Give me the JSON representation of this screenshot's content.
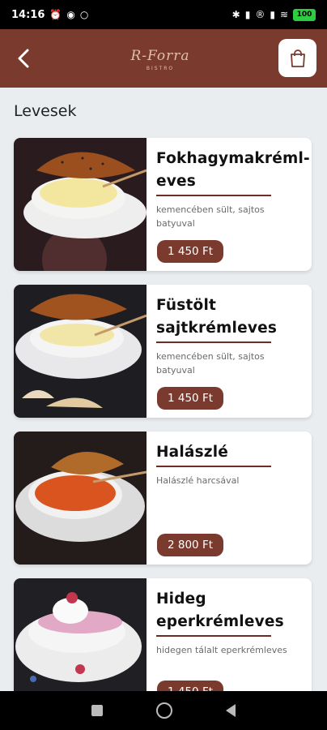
{
  "status_bar": {
    "time": "14:16",
    "left_icons": [
      "alarm-icon",
      "messenger-icon",
      "ring-icon"
    ],
    "right_icons": [
      "bluetooth-icon",
      "signal-icon",
      "roaming-icon",
      "signal-icon",
      "wifi-icon"
    ],
    "battery": "100"
  },
  "header": {
    "logo_text": "R-Forra",
    "logo_sub": "BISTRO",
    "brand_color": "#7a3a2e"
  },
  "section": {
    "title": "Levesek"
  },
  "items": [
    {
      "title_line1": "Fokhagymakréml-",
      "title_line2": "eves",
      "description": "kemencében sült, sajtos batyuval",
      "price": "1 450 Ft"
    },
    {
      "title_line1": "Füstölt",
      "title_line2": "sajtkrémleves",
      "description": "kemencében sült, sajtos batyuval",
      "price": "1 450 Ft"
    },
    {
      "title_line1": "Halászlé",
      "title_line2": "",
      "description": "Halászlé harcsával",
      "price": "2 800 Ft"
    },
    {
      "title_line1": "Hideg",
      "title_line2": "eperkrémleves",
      "description": "hidegen tálalt eperkrémleves",
      "price": "1 450 Ft"
    }
  ],
  "nav": {
    "icons": [
      "recents-icon",
      "home-icon",
      "back-icon"
    ]
  }
}
